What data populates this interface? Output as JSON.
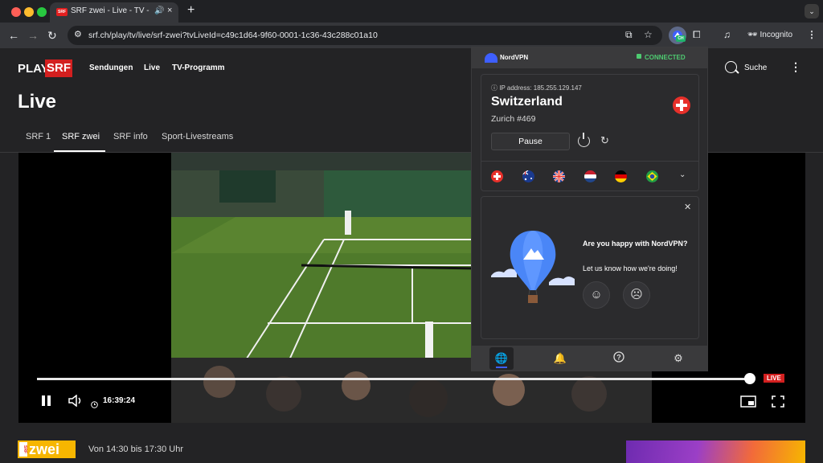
{
  "browser": {
    "tab": {
      "favicon_text": "SRF",
      "title": "SRF zwei - Live - TV - Play SRF"
    },
    "url": "srf.ch/play/tv/live/srf-zwei?tvLiveId=c49c1d64-9f60-0001-1c36-43c288c01a10",
    "incognito_label": "Incognito",
    "extension_badge": "CH"
  },
  "site": {
    "logo_play": "PLAY",
    "logo_srf": "SRF",
    "nav": [
      "Sendungen",
      "Live",
      "TV-Programm"
    ],
    "search_label": "Suche",
    "page_title": "Live",
    "channel_tabs": [
      "SRF 1",
      "SRF zwei",
      "SRF info",
      "Sport-Livestreams"
    ],
    "active_channel": "SRF zwei"
  },
  "player": {
    "time": "16:39:24",
    "live_badge": "LIVE",
    "progress_fraction": 1.0
  },
  "program": {
    "channel_logo_srf": "SRF",
    "channel_logo_text": "zwei",
    "airtime": "Von 14:30 bis 17:30 Uhr"
  },
  "nordvpn": {
    "brand": "NordVPN",
    "status": "CONNECTED",
    "ip_label": "IP address: 185.255.129.147",
    "country": "Switzerland",
    "server": "Zurich #469",
    "pause_label": "Pause",
    "quick_flags": [
      "switzerland-flag",
      "australia-flag",
      "united-kingdom-flag",
      "netherlands-flag",
      "germany-flag",
      "brazil-flag"
    ],
    "feedback": {
      "question": "Are you happy with NordVPN?",
      "prompt": "Let us know how we're doing!"
    },
    "footer_icons": [
      "globe-icon",
      "bell-icon",
      "help-icon",
      "settings-icon"
    ],
    "accent": "#3e5fff",
    "connected_color": "#4ecb71"
  }
}
